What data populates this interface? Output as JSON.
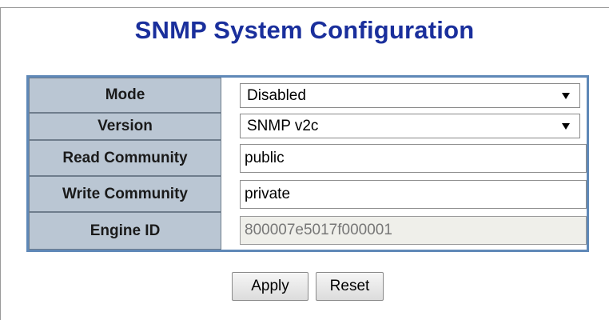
{
  "page": {
    "title": "SNMP System Configuration"
  },
  "form": {
    "mode": {
      "label": "Mode",
      "value": "Disabled"
    },
    "version": {
      "label": "Version",
      "value": "SNMP v2c"
    },
    "read_community": {
      "label": "Read Community",
      "value": "public"
    },
    "write_community": {
      "label": "Write Community",
      "value": "private"
    },
    "engine_id": {
      "label": "Engine ID",
      "value": "800007e5017f000001"
    }
  },
  "buttons": {
    "apply": "Apply",
    "reset": "Reset"
  },
  "colors": {
    "title": "#1a2f9c",
    "frame_border": "#5f88b7",
    "label_background": "#bac6d3",
    "readonly_background": "#efefea"
  },
  "icons": {
    "dropdown": "chevron-down-icon"
  }
}
